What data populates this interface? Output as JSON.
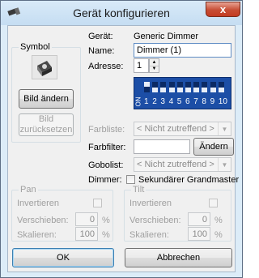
{
  "window": {
    "title": "Gerät konfigurieren",
    "close_glyph": "x"
  },
  "symbol": {
    "group_title": "Symbol",
    "icon": "dimmer-fixture-icon",
    "change_label": "Bild ändern",
    "reset_label": "Bild zurücksetzen"
  },
  "device": {
    "type_label": "Gerät:",
    "type_value": "Generic Dimmer",
    "name_label": "Name:",
    "name_value": "Dimmer (1)",
    "address_label": "Adresse:",
    "address_value": "1"
  },
  "dip": {
    "on_label": "ON",
    "labels": [
      "1",
      "2",
      "3",
      "4",
      "5",
      "6",
      "7",
      "8",
      "9",
      "10"
    ],
    "states": [
      1,
      0,
      0,
      0,
      0,
      0,
      0,
      0,
      0,
      0
    ],
    "color": "#1c4ea6"
  },
  "fields": {
    "colorlist_label": "Farbliste:",
    "colorlist_value": "< Nicht zutreffend >",
    "colorfilter_label": "Farbfilter:",
    "colorfilter_value": "",
    "change_label": "Ändern",
    "gobolist_label": "Gobolist:",
    "gobolist_value": "< Nicht zutreffend >",
    "dimmer_label": "Dimmer:",
    "grandmaster_label": "Sekundärer Grandmaster",
    "grandmaster_checked": false
  },
  "pan": {
    "title": "Pan",
    "invert_label": "Invertieren",
    "shift_label": "Verschieben:",
    "shift_value": "0",
    "shift_unit": "%",
    "scale_label": "Skalieren:",
    "scale_value": "100",
    "scale_unit": "%"
  },
  "tilt": {
    "title": "Tilt",
    "invert_label": "Invertieren",
    "shift_label": "Verschieben:",
    "shift_value": "0",
    "shift_unit": "%",
    "scale_label": "Skalieren:",
    "scale_value": "100",
    "scale_unit": "%"
  },
  "buttons": {
    "ok": "OK",
    "cancel": "Abbrechen"
  }
}
